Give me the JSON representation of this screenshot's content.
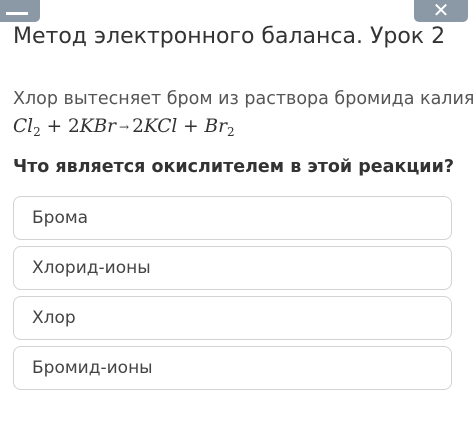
{
  "header": {
    "minimize_icon": "minus-icon",
    "close_icon": "close-icon",
    "close_glyph": "✕"
  },
  "lesson": {
    "title": "Метод электронного баланса. Урок 2"
  },
  "task": {
    "prompt": "Хлор вытесняет бром из раствора бромида калия.",
    "equation": {
      "cl": "Cl",
      "cl_sub": "2",
      "plus1": " + 2",
      "kbr": "KBr",
      "arrow": "→",
      "coef2": "2",
      "kcl": "KCl",
      "plus2": " + ",
      "br": "Br",
      "br_sub": "2"
    },
    "question": "Что является окислителем в этой реакции?"
  },
  "options": [
    {
      "label": "Брома"
    },
    {
      "label": "Хлорид-ионы"
    },
    {
      "label": "Хлор"
    },
    {
      "label": "Бромид-ионы"
    }
  ],
  "colors": {
    "top_button": "#8b98a5",
    "option_border": "#d3d3d3",
    "text": "#333333"
  }
}
